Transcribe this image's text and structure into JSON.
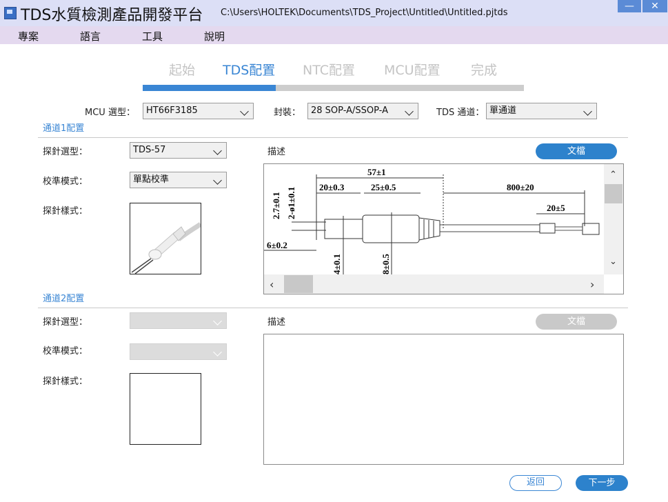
{
  "window": {
    "title": "TDS水質檢測產品開發平台",
    "path": "C:\\Users\\HOLTEK\\Documents\\TDS_Project\\Untitled\\Untitled.pjtds",
    "minimize_glyph": "—",
    "close_glyph": "✕"
  },
  "menu": [
    "專案",
    "語言",
    "工具",
    "說明"
  ],
  "steps": [
    {
      "label": "起始",
      "active": false
    },
    {
      "label": "TDS配置",
      "active": true
    },
    {
      "label": "NTC配置",
      "active": false
    },
    {
      "label": "MCU配置",
      "active": false
    },
    {
      "label": "完成",
      "active": false
    }
  ],
  "progress": {
    "completed_steps": 1,
    "total_steps": 3.5
  },
  "top_config": {
    "mcu_label": "MCU 選型：",
    "mcu_value": "HT66F3185",
    "package_label": "封裝：",
    "package_value": "28 SOP-A/SSOP-A",
    "channel_label": "TDS 通道：",
    "channel_value": "單通道"
  },
  "channel1": {
    "title": "通道1配置",
    "probe_type_label": "探針選型：",
    "probe_type_value": "TDS-57",
    "calib_label": "校準模式：",
    "calib_value": "單點校準",
    "probe_style_label": "探針樣式：",
    "desc_label": "描述",
    "doc_button": "文檔",
    "drawing": {
      "dim_total": "57±1",
      "dim_a": "20±0.3",
      "dim_b": "25±0.5",
      "dim_cable": "800±20",
      "dim_end": "20±5",
      "dim_h1": "2.7±0.1",
      "dim_h2": "2-ø1±0.1",
      "dim_tip": "6±0.2",
      "dim_d1": "4±0.1",
      "dim_d2": "8±0.5"
    }
  },
  "channel2": {
    "title": "通道2配置",
    "probe_type_label": "探針選型：",
    "calib_label": "校準模式：",
    "probe_style_label": "探針樣式：",
    "desc_label": "描述",
    "doc_button": "文檔"
  },
  "footer": {
    "back": "返回",
    "next": "下一步"
  },
  "colors": {
    "accent": "#3a86d4",
    "titlebar": "#dcdff6",
    "menubar": "#e4d9ef"
  }
}
